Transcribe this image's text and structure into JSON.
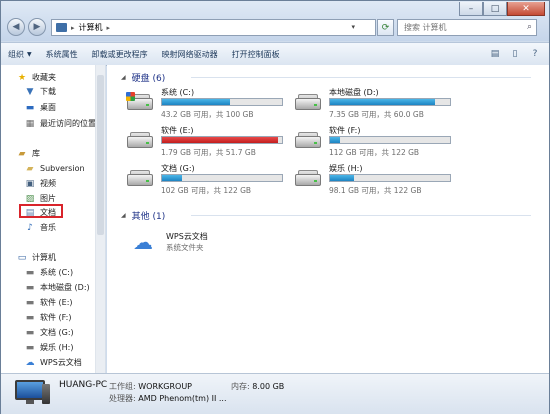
{
  "address": {
    "crumb": "计算机"
  },
  "search": {
    "placeholder": "搜索 计算机"
  },
  "toolbar": {
    "items": [
      "组织",
      "系统属性",
      "卸载或更改程序",
      "映射网络驱动器",
      "打开控制面板"
    ]
  },
  "nav": {
    "favorites": "收藏夹",
    "downloads": "下载",
    "desktop": "桌面",
    "recent": "最近访问的位置",
    "libraries": "库",
    "subversion": "Subversion",
    "video": "视频",
    "pictures": "图片",
    "documents": "文档",
    "music": "音乐",
    "computer": "计算机",
    "drives": [
      "系统 (C:)",
      "本地磁盘 (D:)",
      "软件 (E:)",
      "软件 (F:)",
      "文档 (G:)",
      "娱乐 (H:)",
      "WPS云文档"
    ]
  },
  "main": {
    "hdd_header": "硬盘 (6)",
    "other_header": "其他 (1)",
    "drives": [
      {
        "name": "系统 (C:)",
        "info": "43.2 GB 可用，共 100 GB",
        "used": 0.568,
        "color": "#1d84c2"
      },
      {
        "name": "本地磁盘 (D:)",
        "info": "7.35 GB 可用，共 60.0 GB",
        "used": 0.8775,
        "color": "#1d84c2"
      },
      {
        "name": "软件 (E:)",
        "info": "1.79 GB 可用，共 51.7 GB",
        "used": 0.9654,
        "color": "#c21d1d"
      },
      {
        "name": "软件 (F:)",
        "info": "112 GB 可用，共 122 GB",
        "used": 0.082,
        "color": "#1d84c2"
      },
      {
        "name": "文档 (G:)",
        "info": "102 GB 可用，共 122 GB",
        "used": 0.164,
        "color": "#1d84c2"
      },
      {
        "name": "娱乐 (H:)",
        "info": "98.1 GB 可用，共 122 GB",
        "used": 0.196,
        "color": "#1d84c2"
      }
    ],
    "wps": {
      "name": "WPS云文档",
      "type": "系统文件夹"
    }
  },
  "details": {
    "host": "HUANG-PC",
    "workgroup_label": "工作组:",
    "workgroup": "WORKGROUP",
    "processor_label": "处理器:",
    "processor": "AMD Phenom(tm) II ...",
    "memory_label": "内存:",
    "memory": "8.00 GB"
  }
}
